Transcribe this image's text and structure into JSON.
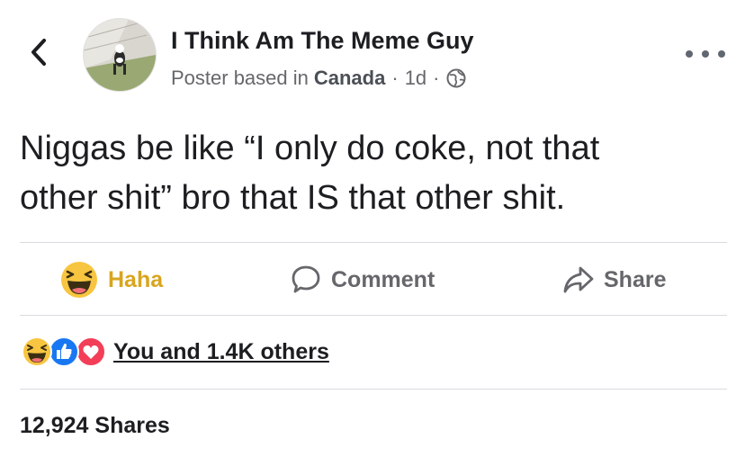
{
  "header": {
    "page_name": "I Think Am The Meme Guy",
    "meta_prefix": "Poster based in",
    "location": "Canada",
    "time": "1d",
    "separator": "·"
  },
  "post": {
    "line1": "Niggas be like “I only do coke, not that",
    "line2": "other shit” bro that IS that other shit."
  },
  "actions": {
    "haha_label": "Haha",
    "comment_label": "Comment",
    "share_label": "Share"
  },
  "reactions": {
    "summary": "You and 1.4K others"
  },
  "shares": {
    "text": "12,924 Shares"
  },
  "colors": {
    "haha_yellow": "#f7c540",
    "like_blue": "#1877f2",
    "love_red": "#f33e58",
    "muted_text": "#65676b"
  },
  "icons": [
    "back-chevron-icon",
    "more-dots-icon",
    "globe-icon",
    "haha-icon",
    "comment-icon",
    "share-icon",
    "like-icon",
    "love-icon"
  ]
}
